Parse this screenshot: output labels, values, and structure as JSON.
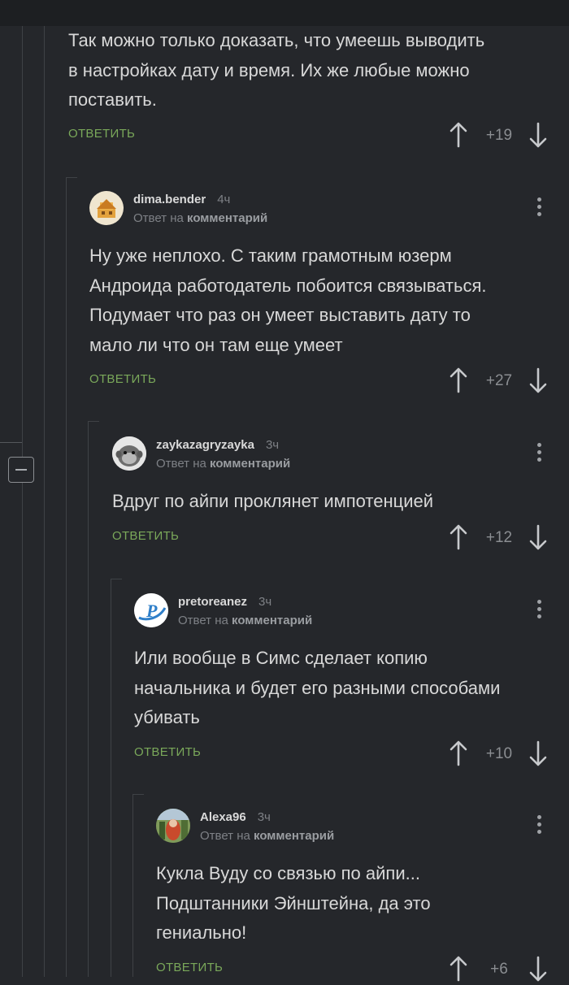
{
  "colors": {
    "background": "#25272b",
    "reply_link": "#7aa85a",
    "thread_line": "#3f4246"
  },
  "thread": {
    "collapse_icon": "minus-square-icon"
  },
  "comments": [
    {
      "text": [
        "Так можно только доказать, что умеешь выводить",
        "в настройках дату и время. Их же любые можно",
        "поставить."
      ],
      "reply_label": "ОТВЕТИТЬ",
      "rating": "+19"
    },
    {
      "author": "dima.bender",
      "time": "4ч",
      "reply_prefix": "Ответ на",
      "reply_target": "комментарий",
      "avatar_icon": "house-avatar-icon",
      "text": [
        "Ну уже неплохо. С таким грамотным юзерм",
        "Андроида работодатель побоится связываться.",
        "Подумает что раз он умеет выставить дату то",
        "мало ли что он там еще умеет"
      ],
      "reply_label": "ОТВЕТИТЬ",
      "rating": "+27"
    },
    {
      "author": "zaykazagryzayka",
      "time": "3ч",
      "reply_prefix": "Ответ на",
      "reply_target": "комментарий",
      "avatar_icon": "monkey-avatar-icon",
      "text": [
        "Вдруг по айпи проклянет импотенцией"
      ],
      "reply_label": "ОТВЕТИТЬ",
      "rating": "+12"
    },
    {
      "author": "pretoreanez",
      "time": "3ч",
      "reply_prefix": "Ответ на",
      "reply_target": "комментарий",
      "avatar_icon": "letter-p-avatar-icon",
      "avatar_letter": "P",
      "text": [
        "Или вообще в Симс сделает копию",
        "начальника и будет его разными способами",
        "убивать"
      ],
      "reply_label": "ОТВЕТИТЬ",
      "rating": "+10"
    },
    {
      "author": "Alexa96",
      "time": "3ч",
      "reply_prefix": "Ответ на",
      "reply_target": "комментарий",
      "avatar_icon": "photo-avatar-icon",
      "text": [
        "Кукла Вуду со связью по айпи...",
        "Подштанники Эйнштейна, да это",
        "гениально!"
      ],
      "reply_label": "ОТВЕТИТЬ",
      "rating": "+6"
    }
  ]
}
